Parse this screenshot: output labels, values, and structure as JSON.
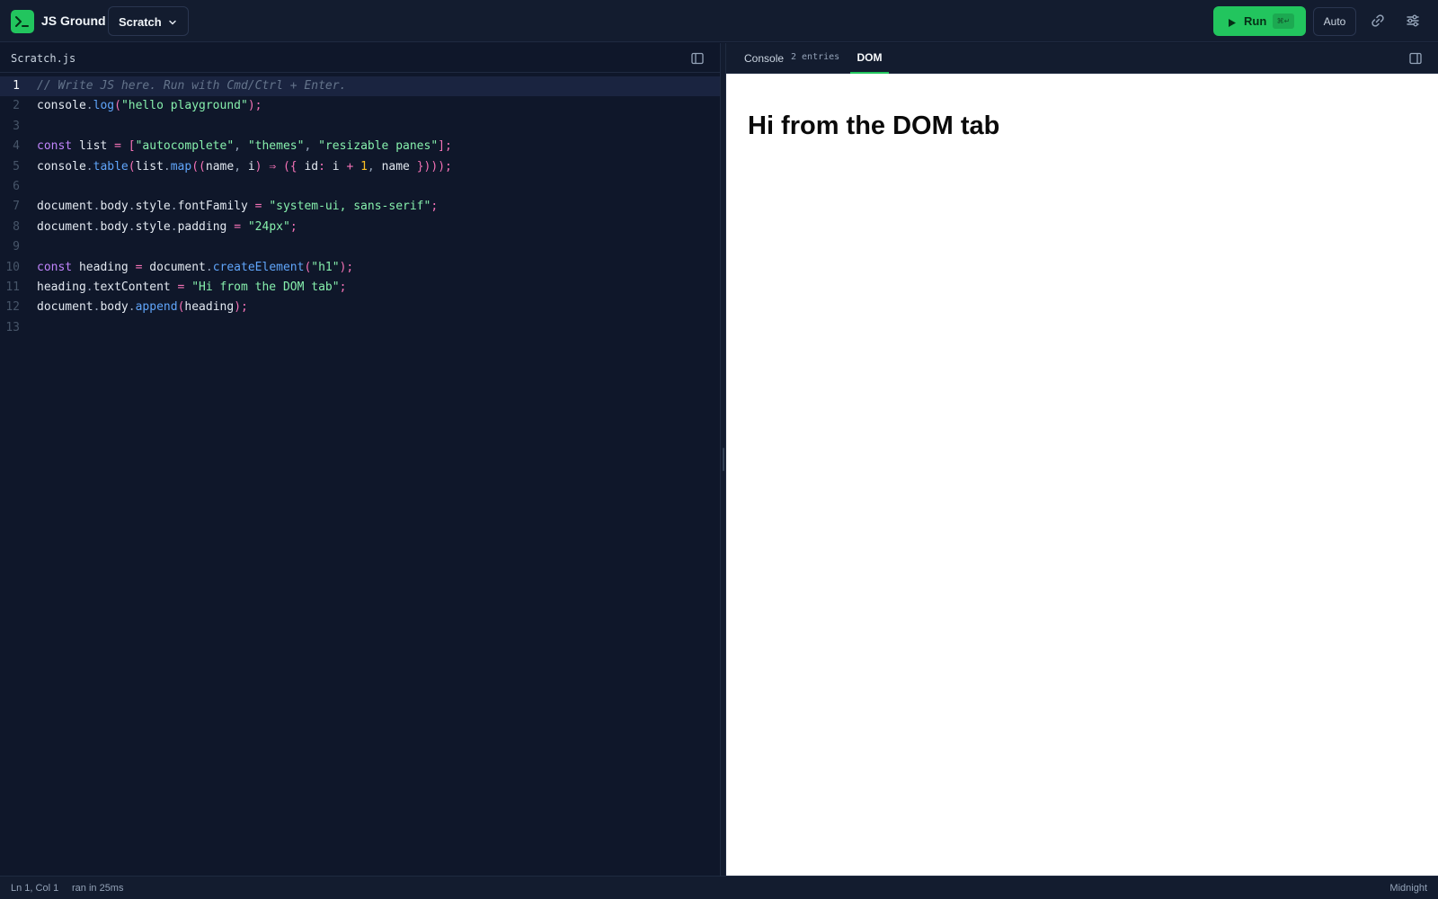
{
  "app": {
    "name": "JS Ground",
    "project": "Scratch"
  },
  "toolbar": {
    "run_label": "Run",
    "run_shortcut": "⌘↵",
    "auto_label": "Auto"
  },
  "editor": {
    "filename": "Scratch.js",
    "active_line": 1,
    "lines": [
      {
        "n": "1",
        "tokens": [
          {
            "c": "cm",
            "t": "// Write JS here. Run with Cmd/Ctrl + Enter."
          }
        ]
      },
      {
        "n": "2",
        "tokens": [
          {
            "c": "id",
            "t": "console"
          },
          {
            "c": "pu",
            "t": "."
          },
          {
            "c": "fn",
            "t": "log"
          },
          {
            "c": "pn",
            "t": "("
          },
          {
            "c": "str",
            "t": "\"hello playground\""
          },
          {
            "c": "pn",
            "t": ");"
          }
        ]
      },
      {
        "n": "3",
        "tokens": []
      },
      {
        "n": "4",
        "tokens": [
          {
            "c": "kw",
            "t": "const"
          },
          {
            "c": "id",
            "t": " list "
          },
          {
            "c": "pn",
            "t": "= ["
          },
          {
            "c": "str",
            "t": "\"autocomplete\""
          },
          {
            "c": "pu",
            "t": ", "
          },
          {
            "c": "str",
            "t": "\"themes\""
          },
          {
            "c": "pu",
            "t": ", "
          },
          {
            "c": "str",
            "t": "\"resizable panes\""
          },
          {
            "c": "pn",
            "t": "];"
          }
        ]
      },
      {
        "n": "5",
        "tokens": [
          {
            "c": "id",
            "t": "console"
          },
          {
            "c": "pu",
            "t": "."
          },
          {
            "c": "fn",
            "t": "table"
          },
          {
            "c": "pn",
            "t": "("
          },
          {
            "c": "id",
            "t": "list"
          },
          {
            "c": "pu",
            "t": "."
          },
          {
            "c": "fn",
            "t": "map"
          },
          {
            "c": "pn",
            "t": "(("
          },
          {
            "c": "id",
            "t": "name"
          },
          {
            "c": "pu",
            "t": ", "
          },
          {
            "c": "id",
            "t": "i"
          },
          {
            "c": "pn",
            "t": ") ⇒ ({ "
          },
          {
            "c": "id",
            "t": "id"
          },
          {
            "c": "pn",
            "t": ": "
          },
          {
            "c": "id",
            "t": "i "
          },
          {
            "c": "pn",
            "t": "+ "
          },
          {
            "c": "num",
            "t": "1"
          },
          {
            "c": "pu",
            "t": ", "
          },
          {
            "c": "id",
            "t": "name "
          },
          {
            "c": "pn",
            "t": "})));"
          }
        ]
      },
      {
        "n": "6",
        "tokens": []
      },
      {
        "n": "7",
        "tokens": [
          {
            "c": "id",
            "t": "document"
          },
          {
            "c": "pu",
            "t": "."
          },
          {
            "c": "id",
            "t": "body"
          },
          {
            "c": "pu",
            "t": "."
          },
          {
            "c": "id",
            "t": "style"
          },
          {
            "c": "pu",
            "t": "."
          },
          {
            "c": "id",
            "t": "fontFamily "
          },
          {
            "c": "pn",
            "t": "= "
          },
          {
            "c": "str",
            "t": "\"system-ui, sans-serif\""
          },
          {
            "c": "pn",
            "t": ";"
          }
        ]
      },
      {
        "n": "8",
        "tokens": [
          {
            "c": "id",
            "t": "document"
          },
          {
            "c": "pu",
            "t": "."
          },
          {
            "c": "id",
            "t": "body"
          },
          {
            "c": "pu",
            "t": "."
          },
          {
            "c": "id",
            "t": "style"
          },
          {
            "c": "pu",
            "t": "."
          },
          {
            "c": "id",
            "t": "padding "
          },
          {
            "c": "pn",
            "t": "= "
          },
          {
            "c": "str",
            "t": "\"24px\""
          },
          {
            "c": "pn",
            "t": ";"
          }
        ]
      },
      {
        "n": "9",
        "tokens": []
      },
      {
        "n": "10",
        "tokens": [
          {
            "c": "kw",
            "t": "const"
          },
          {
            "c": "id",
            "t": " heading "
          },
          {
            "c": "pn",
            "t": "= "
          },
          {
            "c": "id",
            "t": "document"
          },
          {
            "c": "pu",
            "t": "."
          },
          {
            "c": "fn",
            "t": "createElement"
          },
          {
            "c": "pn",
            "t": "("
          },
          {
            "c": "str",
            "t": "\"h1\""
          },
          {
            "c": "pn",
            "t": ");"
          }
        ]
      },
      {
        "n": "11",
        "tokens": [
          {
            "c": "id",
            "t": "heading"
          },
          {
            "c": "pu",
            "t": "."
          },
          {
            "c": "id",
            "t": "textContent "
          },
          {
            "c": "pn",
            "t": "= "
          },
          {
            "c": "str",
            "t": "\"Hi from the DOM tab\""
          },
          {
            "c": "pn",
            "t": ";"
          }
        ]
      },
      {
        "n": "12",
        "tokens": [
          {
            "c": "id",
            "t": "document"
          },
          {
            "c": "pu",
            "t": "."
          },
          {
            "c": "id",
            "t": "body"
          },
          {
            "c": "pu",
            "t": "."
          },
          {
            "c": "fn",
            "t": "append"
          },
          {
            "c": "pn",
            "t": "("
          },
          {
            "c": "id",
            "t": "heading"
          },
          {
            "c": "pn",
            "t": ");"
          }
        ]
      },
      {
        "n": "13",
        "tokens": []
      }
    ]
  },
  "preview": {
    "tabs": {
      "console": "Console",
      "console_count": "2 entries",
      "dom": "DOM"
    },
    "active_tab": "DOM",
    "dom_heading": "Hi from the DOM tab"
  },
  "status": {
    "position": "Ln 1, Col 1",
    "run_time": "ran in 25ms",
    "theme": "Midnight"
  },
  "colors": {
    "accent": "#22c55e",
    "background": "#0f172a",
    "header": "#131c2f"
  },
  "icons": {
    "logo": "terminal-icon",
    "dropdown": "chevron-down-icon",
    "run": "play-icon",
    "share": "link-icon",
    "settings": "sliders-icon",
    "layout": "panel-icon"
  }
}
